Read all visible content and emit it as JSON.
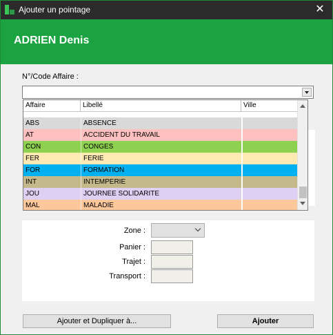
{
  "window": {
    "title": "Ajouter un pointage",
    "close_glyph": "✕",
    "accent_color": "#1aa340"
  },
  "header": {
    "person_name": "ADRIEN Denis"
  },
  "code_affaire": {
    "label": "N°/Code Affaire :",
    "value": ""
  },
  "dropdown": {
    "columns": [
      "Affaire",
      "Libellé",
      "Ville"
    ],
    "partial_text": "...",
    "rows": [
      {
        "code": "ABS",
        "label": "ABSENCE",
        "ville": "",
        "color": "#d9d9d9"
      },
      {
        "code": "AT",
        "label": "ACCIDENT DU TRAVAIL",
        "ville": "",
        "color": "#ffc0c0"
      },
      {
        "code": "CON",
        "label": "CONGES",
        "ville": "",
        "color": "#8ed04f"
      },
      {
        "code": "FER",
        "label": "FERIE",
        "ville": "",
        "color": "#fde9b2"
      },
      {
        "code": "FOR",
        "label": "FORMATION",
        "ville": "",
        "color": "#00b0f0"
      },
      {
        "code": "INT",
        "label": "INTEMPERIE",
        "ville": "",
        "color": "#c4b98a"
      },
      {
        "code": "JOU",
        "label": "JOURNEE SOLIDARITE",
        "ville": "",
        "color": "#ddd0f2"
      },
      {
        "code": "MAL",
        "label": "MALADIE",
        "ville": "",
        "color": "#fdc79c"
      }
    ]
  },
  "form": {
    "zone_label": "Zone :",
    "zone_value": "",
    "panier_label": "Panier :",
    "panier_value": "",
    "trajet_label": "Trajet :",
    "trajet_value": "",
    "transport_label": "Transport :",
    "transport_value": ""
  },
  "buttons": {
    "duplicate": "Ajouter et Dupliquer à...",
    "add": "Ajouter"
  }
}
